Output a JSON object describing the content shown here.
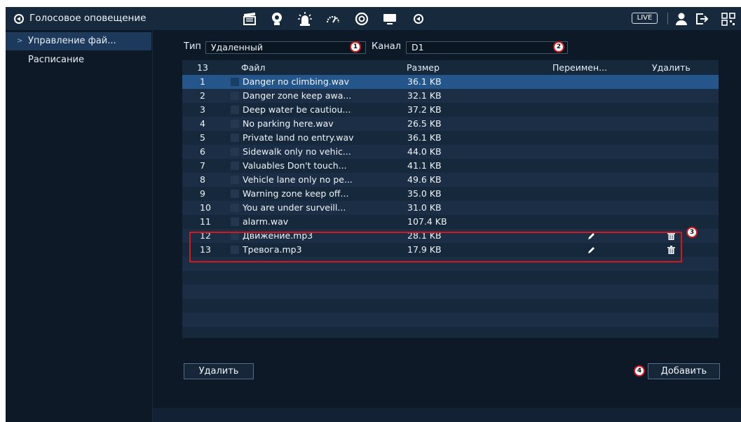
{
  "topbar": {
    "title": "Голосовое оповещение",
    "live_label": "LIVE",
    "icons": [
      "speaker-icon",
      "clapperboard-icon",
      "face-icon",
      "alarm-light-icon",
      "gauge-icon",
      "sync-icon",
      "monitor-icon",
      "speaker-icon",
      "user-icon",
      "logout-icon",
      "qr-code-icon"
    ]
  },
  "sidebar": {
    "items": [
      {
        "label": "Управление фай...",
        "active": true
      },
      {
        "label": "Расписание",
        "active": false
      }
    ]
  },
  "filter": {
    "type_label": "Тип",
    "type_value": "Удаленный",
    "channel_label": "Канал",
    "channel_value": "D1"
  },
  "table": {
    "headers": {
      "count": "13",
      "file": "Файл",
      "size": "Размер",
      "rename": "Переимен...",
      "delete": "Удалить"
    },
    "rows": [
      {
        "num": "1",
        "file": "Danger no climbing.wav",
        "size": "36.1 KB"
      },
      {
        "num": "2",
        "file": "Danger zone keep awa...",
        "size": "32.1 KB"
      },
      {
        "num": "3",
        "file": "Deep water be cautiou...",
        "size": "37.2 KB"
      },
      {
        "num": "4",
        "file": "No parking here.wav",
        "size": "26.5 KB"
      },
      {
        "num": "5",
        "file": "Private land no entry.wav",
        "size": "36.1 KB"
      },
      {
        "num": "6",
        "file": "Sidewalk only no vehic...",
        "size": "44.0 KB"
      },
      {
        "num": "7",
        "file": "Valuables Don't touch...",
        "size": "41.1 KB"
      },
      {
        "num": "8",
        "file": "Vehicle lane only no pe...",
        "size": "49.6 KB"
      },
      {
        "num": "9",
        "file": "Warning zone keep off...",
        "size": "35.0 KB"
      },
      {
        "num": "10",
        "file": "You are under surveill...",
        "size": "31.0 KB"
      },
      {
        "num": "11",
        "file": "alarm.wav",
        "size": "107.4 KB"
      },
      {
        "num": "12",
        "file": "Движение.mp3",
        "size": "28.1 KB",
        "editable": true
      },
      {
        "num": "13",
        "file": "Тревога.mp3",
        "size": "17.9 KB",
        "editable": true
      }
    ]
  },
  "callouts": [
    "1",
    "2",
    "3",
    "4"
  ],
  "buttons": {
    "delete": "Удалить",
    "add": "Добавить"
  },
  "colors": {
    "highlight": "#d4191c",
    "selected_row": "#24568c",
    "background": "#0d1927"
  }
}
